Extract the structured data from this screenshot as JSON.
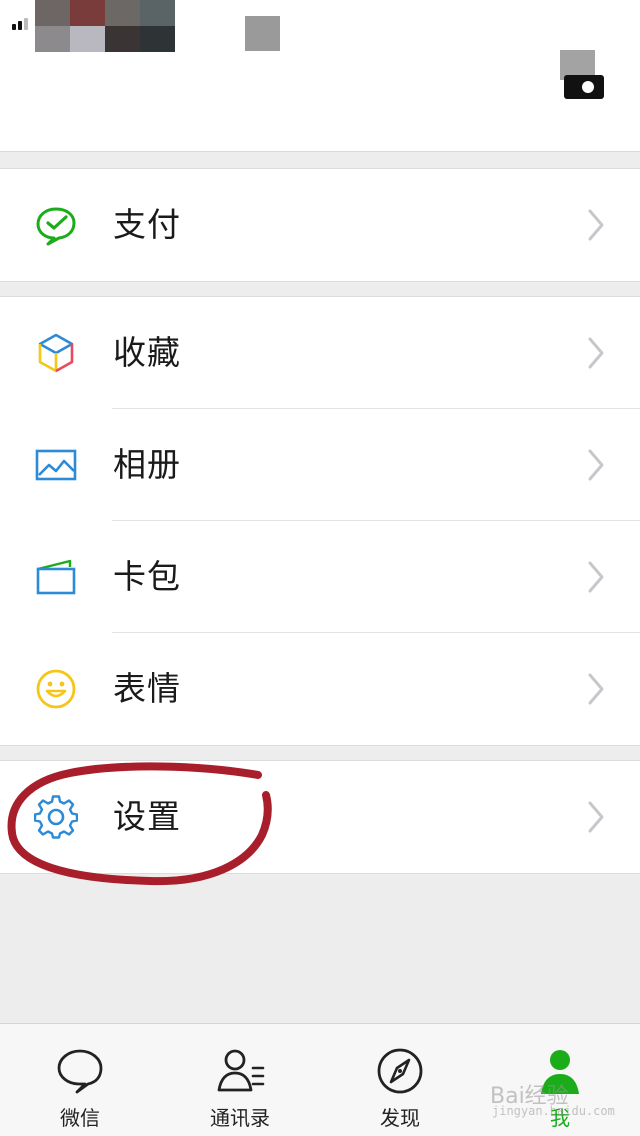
{
  "profile": {
    "mosaic_colors": [
      "#6e6565",
      "#7a3b3b",
      "#6b6866",
      "#5a6466",
      "#8c8a8c",
      "#b9b7bf",
      "#3a3434",
      "#2e3436"
    ],
    "avatar_color": "#9a9a9a"
  },
  "menu": {
    "pay": {
      "label": "支付",
      "icon": "wechat-pay-icon",
      "color": "#1aad19"
    },
    "favorites": {
      "label": "收藏",
      "icon": "cube-icon"
    },
    "album": {
      "label": "相册",
      "icon": "image-icon",
      "color": "#2c8ad6"
    },
    "cards": {
      "label": "卡包",
      "icon": "wallet-icon",
      "color": "#2c8ad6"
    },
    "stickers": {
      "label": "表情",
      "icon": "smiley-icon",
      "color": "#f5c518"
    },
    "settings": {
      "label": "设置",
      "icon": "gear-icon",
      "color": "#2c8ad6"
    }
  },
  "tabs": [
    {
      "label": "微信",
      "icon": "chat-bubble-icon",
      "active": false
    },
    {
      "label": "通讯录",
      "icon": "contacts-icon",
      "active": false
    },
    {
      "label": "发现",
      "icon": "compass-icon",
      "active": false
    },
    {
      "label": "我",
      "icon": "person-icon",
      "active": true
    }
  ],
  "colors": {
    "accent": "#1aad19",
    "annotation": "#a81e2a"
  },
  "watermark": {
    "brand": "Bai经验",
    "sub": "jingyan.baidu.com"
  }
}
